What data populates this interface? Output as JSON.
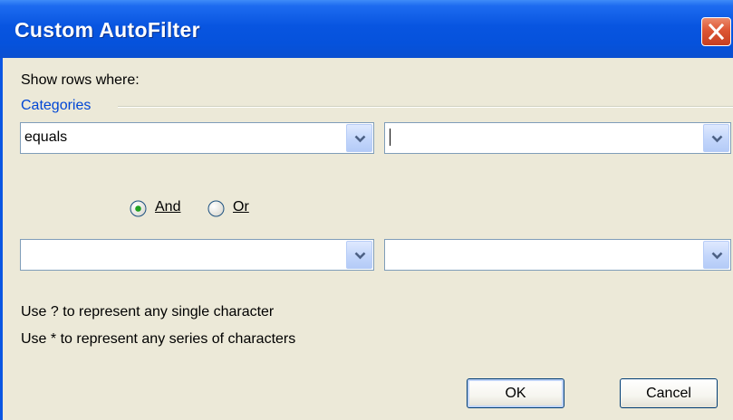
{
  "window": {
    "title": "Custom AutoFilter"
  },
  "dialog": {
    "show_rows_label": "Show rows where:",
    "group_label": "Categories",
    "criteria1": {
      "operator": "equals",
      "value": ""
    },
    "logic": {
      "and_label": "And",
      "or_label": "Or",
      "selected": "And"
    },
    "criteria2": {
      "operator": "",
      "value": ""
    },
    "hint1": "Use ? to represent any single character",
    "hint2": "Use * to represent any series of characters",
    "ok_label": "OK",
    "cancel_label": "Cancel"
  },
  "colors": {
    "title_bar": "#0855e0",
    "dialog_bg": "#ece9d8",
    "group_label": "#0046d5",
    "close_button": "#dd5534"
  },
  "icons": {
    "close": "close-icon",
    "dropdown": "chevron-down-icon",
    "radio": "radio-button-icon"
  }
}
